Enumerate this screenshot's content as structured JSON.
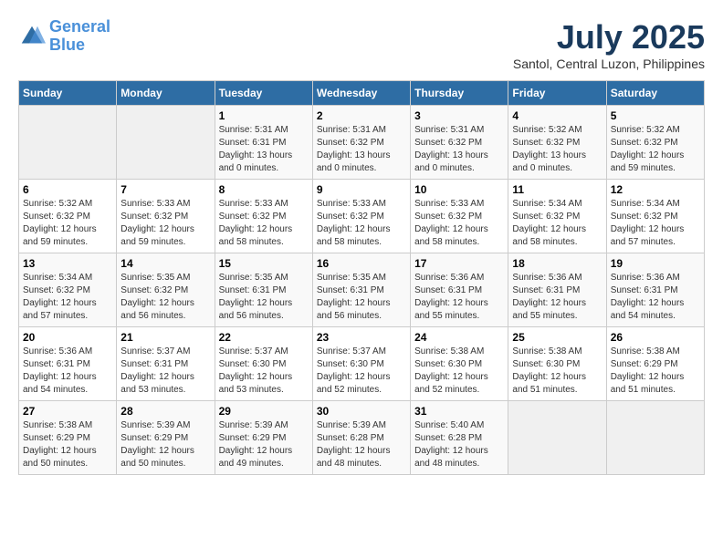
{
  "header": {
    "logo_line1": "General",
    "logo_line2": "Blue",
    "month_title": "July 2025",
    "location": "Santol, Central Luzon, Philippines"
  },
  "weekdays": [
    "Sunday",
    "Monday",
    "Tuesday",
    "Wednesday",
    "Thursday",
    "Friday",
    "Saturday"
  ],
  "weeks": [
    [
      {
        "day": "",
        "empty": true
      },
      {
        "day": "",
        "empty": true
      },
      {
        "day": "1",
        "sunrise": "5:31 AM",
        "sunset": "6:31 PM",
        "daylight": "13 hours and 0 minutes."
      },
      {
        "day": "2",
        "sunrise": "5:31 AM",
        "sunset": "6:32 PM",
        "daylight": "13 hours and 0 minutes."
      },
      {
        "day": "3",
        "sunrise": "5:31 AM",
        "sunset": "6:32 PM",
        "daylight": "13 hours and 0 minutes."
      },
      {
        "day": "4",
        "sunrise": "5:32 AM",
        "sunset": "6:32 PM",
        "daylight": "13 hours and 0 minutes."
      },
      {
        "day": "5",
        "sunrise": "5:32 AM",
        "sunset": "6:32 PM",
        "daylight": "12 hours and 59 minutes."
      }
    ],
    [
      {
        "day": "6",
        "sunrise": "5:32 AM",
        "sunset": "6:32 PM",
        "daylight": "12 hours and 59 minutes."
      },
      {
        "day": "7",
        "sunrise": "5:33 AM",
        "sunset": "6:32 PM",
        "daylight": "12 hours and 59 minutes."
      },
      {
        "day": "8",
        "sunrise": "5:33 AM",
        "sunset": "6:32 PM",
        "daylight": "12 hours and 58 minutes."
      },
      {
        "day": "9",
        "sunrise": "5:33 AM",
        "sunset": "6:32 PM",
        "daylight": "12 hours and 58 minutes."
      },
      {
        "day": "10",
        "sunrise": "5:33 AM",
        "sunset": "6:32 PM",
        "daylight": "12 hours and 58 minutes."
      },
      {
        "day": "11",
        "sunrise": "5:34 AM",
        "sunset": "6:32 PM",
        "daylight": "12 hours and 58 minutes."
      },
      {
        "day": "12",
        "sunrise": "5:34 AM",
        "sunset": "6:32 PM",
        "daylight": "12 hours and 57 minutes."
      }
    ],
    [
      {
        "day": "13",
        "sunrise": "5:34 AM",
        "sunset": "6:32 PM",
        "daylight": "12 hours and 57 minutes."
      },
      {
        "day": "14",
        "sunrise": "5:35 AM",
        "sunset": "6:32 PM",
        "daylight": "12 hours and 56 minutes."
      },
      {
        "day": "15",
        "sunrise": "5:35 AM",
        "sunset": "6:31 PM",
        "daylight": "12 hours and 56 minutes."
      },
      {
        "day": "16",
        "sunrise": "5:35 AM",
        "sunset": "6:31 PM",
        "daylight": "12 hours and 56 minutes."
      },
      {
        "day": "17",
        "sunrise": "5:36 AM",
        "sunset": "6:31 PM",
        "daylight": "12 hours and 55 minutes."
      },
      {
        "day": "18",
        "sunrise": "5:36 AM",
        "sunset": "6:31 PM",
        "daylight": "12 hours and 55 minutes."
      },
      {
        "day": "19",
        "sunrise": "5:36 AM",
        "sunset": "6:31 PM",
        "daylight": "12 hours and 54 minutes."
      }
    ],
    [
      {
        "day": "20",
        "sunrise": "5:36 AM",
        "sunset": "6:31 PM",
        "daylight": "12 hours and 54 minutes."
      },
      {
        "day": "21",
        "sunrise": "5:37 AM",
        "sunset": "6:31 PM",
        "daylight": "12 hours and 53 minutes."
      },
      {
        "day": "22",
        "sunrise": "5:37 AM",
        "sunset": "6:30 PM",
        "daylight": "12 hours and 53 minutes."
      },
      {
        "day": "23",
        "sunrise": "5:37 AM",
        "sunset": "6:30 PM",
        "daylight": "12 hours and 52 minutes."
      },
      {
        "day": "24",
        "sunrise": "5:38 AM",
        "sunset": "6:30 PM",
        "daylight": "12 hours and 52 minutes."
      },
      {
        "day": "25",
        "sunrise": "5:38 AM",
        "sunset": "6:30 PM",
        "daylight": "12 hours and 51 minutes."
      },
      {
        "day": "26",
        "sunrise": "5:38 AM",
        "sunset": "6:29 PM",
        "daylight": "12 hours and 51 minutes."
      }
    ],
    [
      {
        "day": "27",
        "sunrise": "5:38 AM",
        "sunset": "6:29 PM",
        "daylight": "12 hours and 50 minutes."
      },
      {
        "day": "28",
        "sunrise": "5:39 AM",
        "sunset": "6:29 PM",
        "daylight": "12 hours and 50 minutes."
      },
      {
        "day": "29",
        "sunrise": "5:39 AM",
        "sunset": "6:29 PM",
        "daylight": "12 hours and 49 minutes."
      },
      {
        "day": "30",
        "sunrise": "5:39 AM",
        "sunset": "6:28 PM",
        "daylight": "12 hours and 48 minutes."
      },
      {
        "day": "31",
        "sunrise": "5:40 AM",
        "sunset": "6:28 PM",
        "daylight": "12 hours and 48 minutes."
      },
      {
        "day": "",
        "empty": true
      },
      {
        "day": "",
        "empty": true
      }
    ]
  ]
}
